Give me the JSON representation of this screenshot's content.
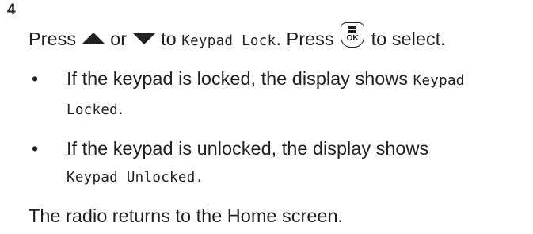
{
  "step": {
    "number": "4",
    "instruction": {
      "press_1": "Press",
      "or": "or",
      "to": "to",
      "menu_item": "Keypad Lock",
      "period": ".",
      "press_2": "Press",
      "to_select": "to select.",
      "up_icon": "up-arrow-icon",
      "down_icon": "down-arrow-icon",
      "ok_icon": "menu-ok-key-icon",
      "ok_key_label": "OK"
    },
    "bullets": [
      {
        "bullet": "•",
        "text": "If the keypad is locked, the display shows",
        "display": "Keypad Locked",
        "end": "."
      },
      {
        "bullet": "•",
        "text": "If the keypad is unlocked, the display shows",
        "display": "Keypad Unlocked.",
        "end": ""
      }
    ],
    "result": "The radio returns to the Home screen."
  }
}
